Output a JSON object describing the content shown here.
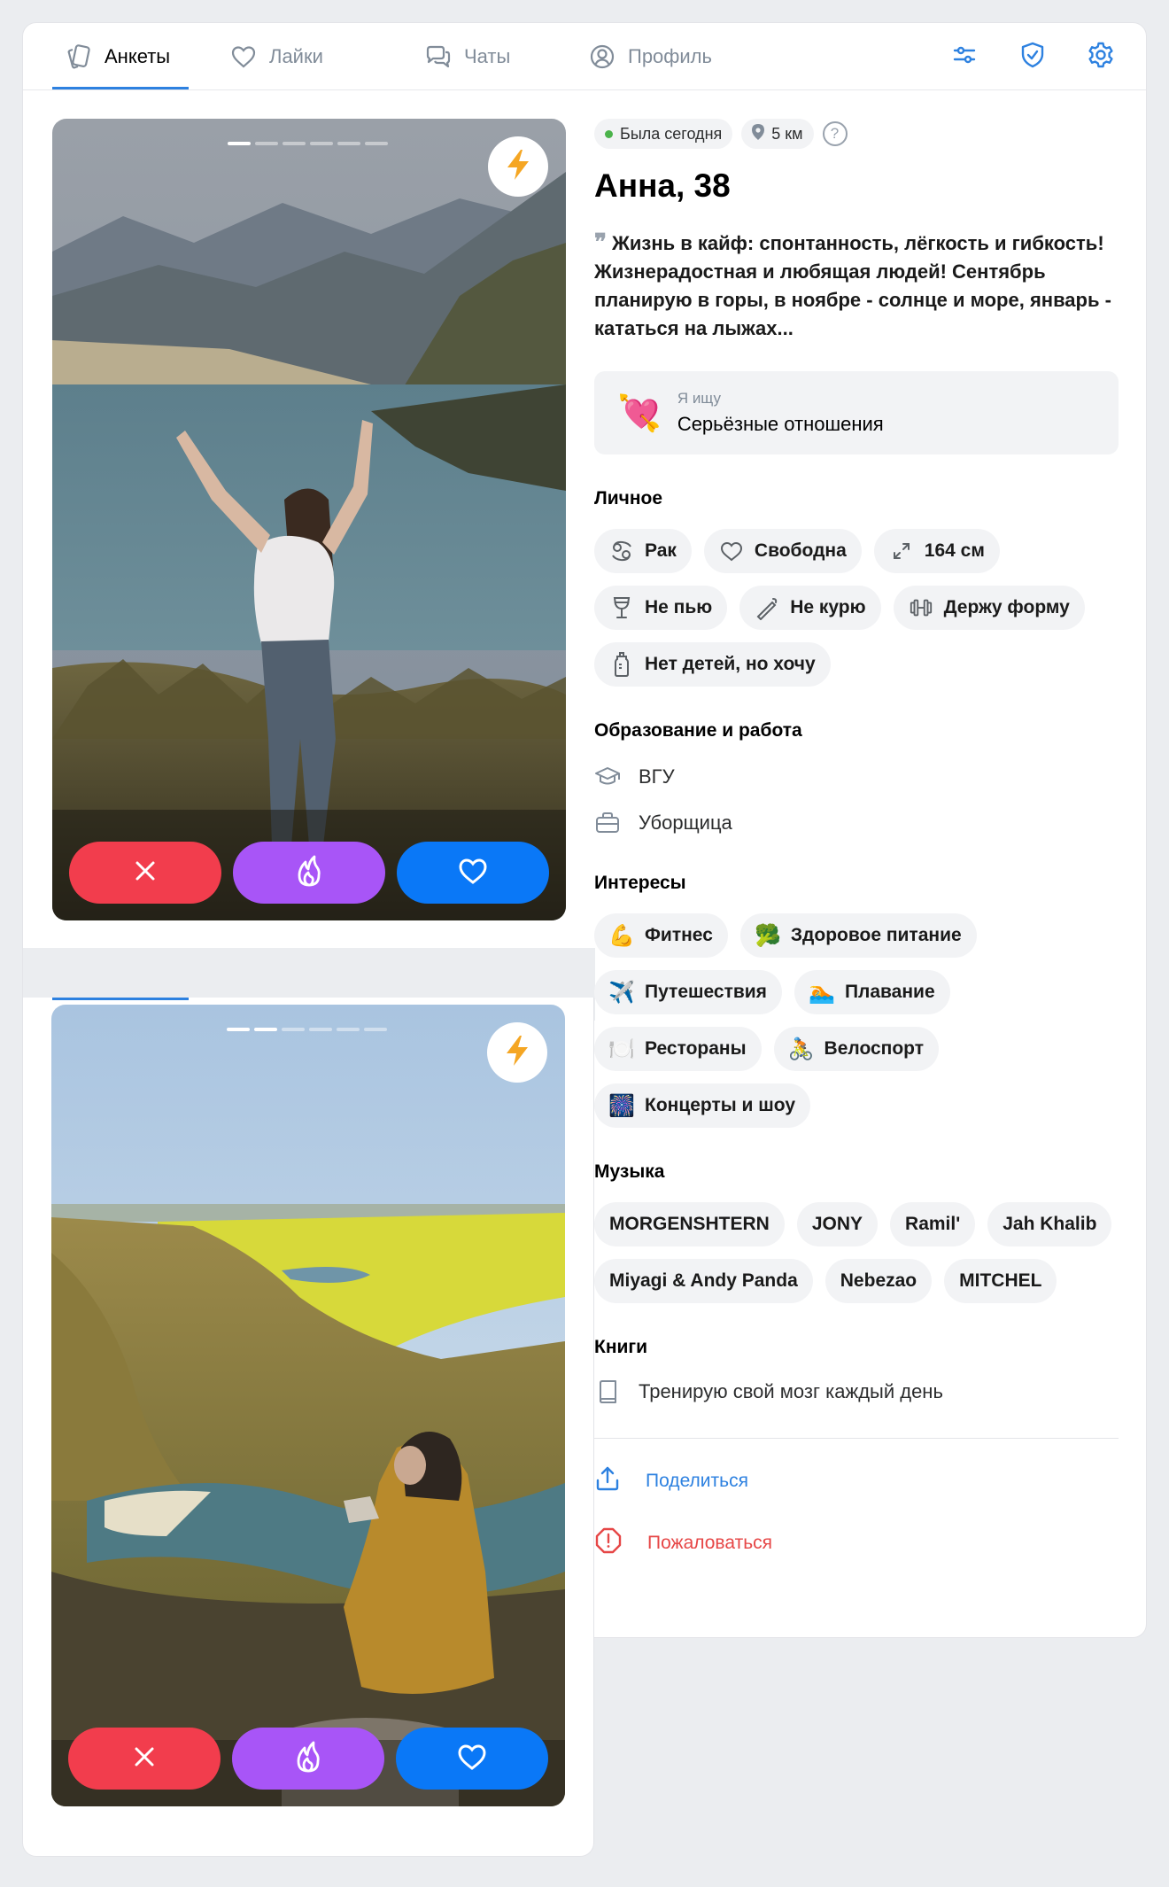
{
  "tabs": [
    {
      "label": "Анкеты",
      "icon": "cards-icon",
      "active": true
    },
    {
      "label": "Лайки",
      "icon": "heart-icon",
      "active": false
    },
    {
      "label": "Чаты",
      "icon": "chat-icon",
      "active": false
    },
    {
      "label": "Профиль",
      "icon": "user-icon",
      "active": false
    }
  ],
  "tools": [
    "filters-icon",
    "shield-icon",
    "gear-icon"
  ],
  "photos": [
    {
      "total": 6,
      "current": 1,
      "scene": "mountain lake"
    },
    {
      "total": 6,
      "current": 2,
      "scene": "river valley"
    }
  ],
  "actions": [
    "dislike-icon",
    "superlike-icon",
    "like-icon"
  ],
  "profile": {
    "status": "Была сегодня",
    "distance": "5 км",
    "help": "?",
    "name": "Анна, 38",
    "bio": "Жизнь в кайф: спонтанность, лёгкость и гибкость! Жизнерадостная и любящая людей! Сентябрь планирую в горы, в ноябре - солнце и море, январь - кататься на лыжах...",
    "seek_label": "Я ищу",
    "seek_value": "Серьёзные отношения",
    "seek_emoji": "💘"
  },
  "personal": {
    "title": "Личное",
    "items": [
      {
        "label": "Рак",
        "icon": "cancer-zodiac-icon"
      },
      {
        "label": "Свободна",
        "icon": "heart-outline-icon"
      },
      {
        "label": "164 см",
        "icon": "height-arrows-icon"
      },
      {
        "label": "Не пью",
        "icon": "wine-glass-icon"
      },
      {
        "label": "Не курю",
        "icon": "cigarette-crossed-icon"
      },
      {
        "label": "Держу форму",
        "icon": "dumbbell-icon"
      },
      {
        "label": "Нет детей, но хочу",
        "icon": "baby-bottle-icon"
      }
    ]
  },
  "education": {
    "title": "Образование и работа",
    "items": [
      {
        "label": "ВГУ",
        "icon": "graduation-cap-icon"
      },
      {
        "label": "Уборщица",
        "icon": "briefcase-icon"
      }
    ]
  },
  "interests": {
    "title": "Интересы",
    "items": [
      {
        "label": "Фитнес",
        "emoji": "💪"
      },
      {
        "label": "Здоровое питание",
        "emoji": "🥦"
      },
      {
        "label": "Путешествия",
        "emoji": "✈️"
      },
      {
        "label": "Плавание",
        "emoji": "🏊"
      },
      {
        "label": "Рестораны",
        "emoji": "🍽️"
      },
      {
        "label": "Велоспорт",
        "emoji": "🚴"
      },
      {
        "label": "Концерты и шоу",
        "emoji": "🎆"
      }
    ]
  },
  "music": {
    "title": "Музыка",
    "items": [
      "MORGENSHTERN",
      "JONY",
      "Ramil'",
      "Jah Khalib",
      "Miyagi & Andy Panda",
      "Nebezao",
      "MITCHEL"
    ]
  },
  "books": {
    "title": "Книги",
    "item": "Тренирую свой мозг каждый день"
  },
  "footer": {
    "share": "Поделиться",
    "report": "Пожаловаться"
  }
}
